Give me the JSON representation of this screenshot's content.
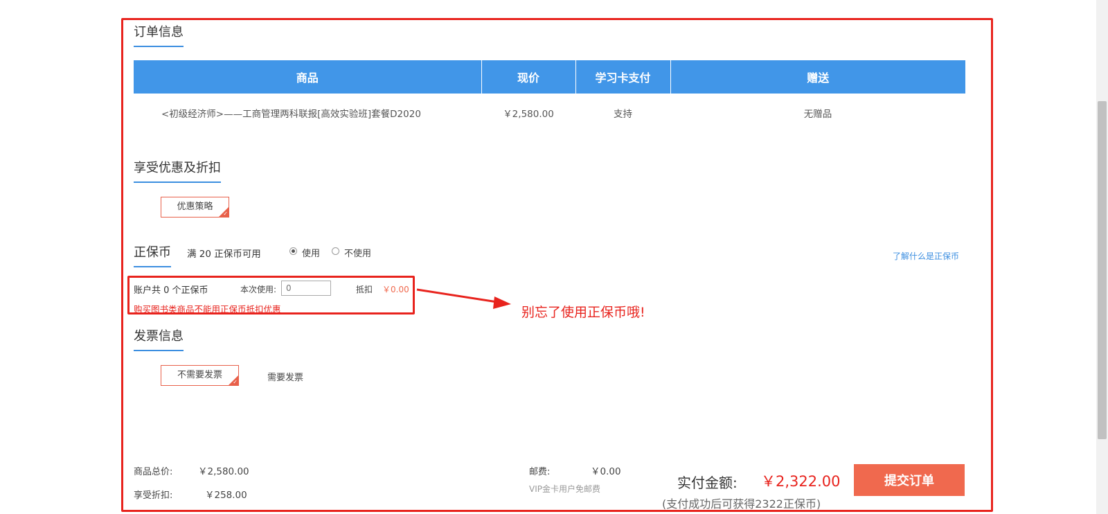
{
  "order_info": {
    "title": "订单信息",
    "columns": [
      "商品",
      "现价",
      "学习卡支付",
      "赠送"
    ],
    "rows": [
      {
        "product": "<初级经济师>——工商管理两科联报[高效实验班]套餐D2020",
        "price": "￥2,580.00",
        "card_pay": "支持",
        "gift": "无赠品"
      }
    ]
  },
  "discount": {
    "title": "享受优惠及折扣",
    "option_label": "优惠策略"
  },
  "coins": {
    "title": "正保币",
    "condition": "满 20 正保币可用",
    "use_label": "使用",
    "not_use_label": "不使用",
    "learn_more": "了解什么是正保币",
    "account_text": "账户共 0 个正保币",
    "use_this_time_label": "本次使用:",
    "use_input_placeholder": "0",
    "deduct_label": "抵扣",
    "deduct_value": "￥0.00",
    "warning": "购买图书类商品不能用正保币抵扣优惠",
    "annotation": "别忘了使用正保币哦!"
  },
  "invoice": {
    "title": "发票信息",
    "no_invoice_label": "不需要发票",
    "need_invoice_label": "需要发票"
  },
  "summary": {
    "total_label": "商品总价:",
    "total_value": "￥2,580.00",
    "discount_label": "享受折扣:",
    "discount_value": "￥258.00",
    "shipping_label": "邮费:",
    "shipping_value": "￥0.00",
    "vip_note": "VIP金卡用户免邮费",
    "pay_label": "实付金额:",
    "pay_value": "￥2,322.00",
    "reward_note": "(支付成功后可获得2322正保币)",
    "submit_label": "提交订单"
  },
  "colors": {
    "accent_blue": "#4196e8",
    "highlight_red": "#e8231d",
    "submit_orange": "#f0694e"
  }
}
